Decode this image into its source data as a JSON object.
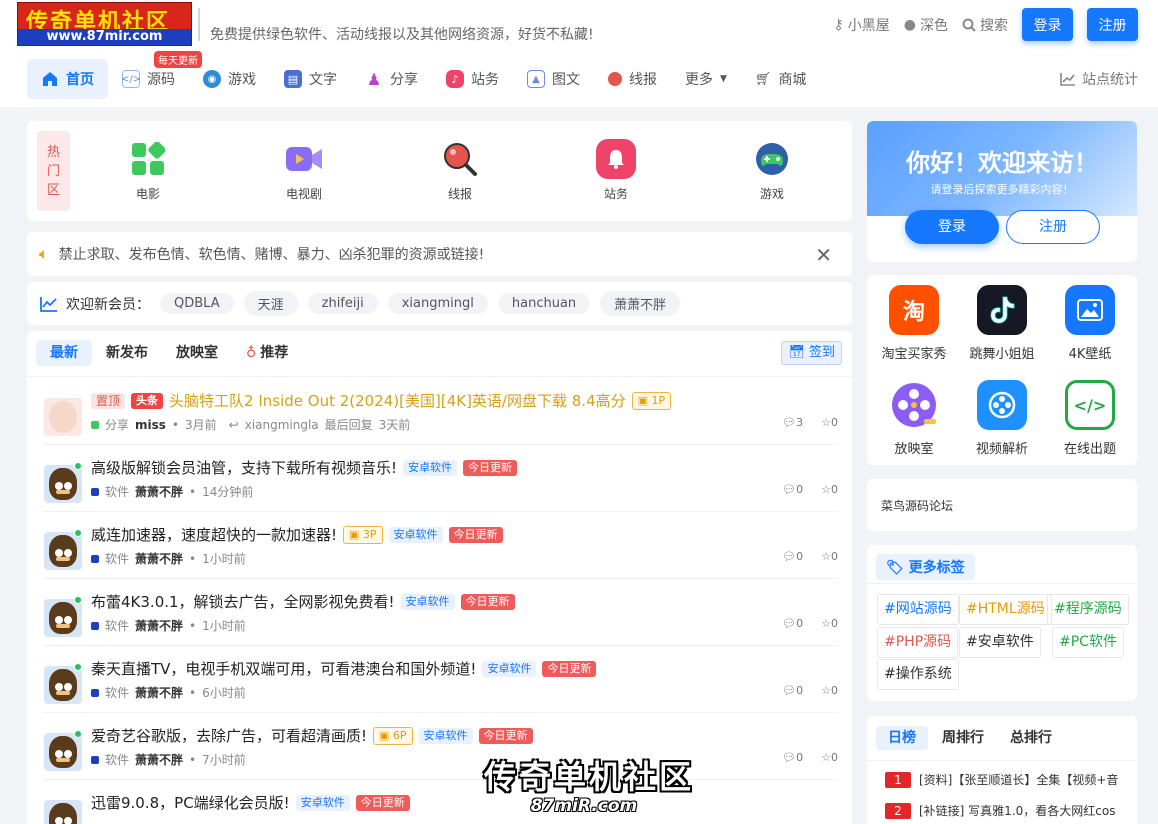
{
  "header": {
    "logo_line1": "传奇单机社区",
    "logo_line2": "www.87mir.com",
    "slogan": "免费提供绿色软件、活动线报以及其他网络资源，好货不私藏!",
    "links": [
      {
        "icon": "key-icon",
        "label": "小黑屋"
      },
      {
        "icon": "moon-icon",
        "label": "深色"
      },
      {
        "icon": "search-icon",
        "label": "搜索"
      }
    ],
    "login": "登录",
    "register": "注册"
  },
  "nav": {
    "items": [
      {
        "label": "首页",
        "icon": "home-icon"
      },
      {
        "label": "源码",
        "icon": "code-icon"
      },
      {
        "label": "游戏",
        "icon": "game-icon"
      },
      {
        "label": "文字",
        "icon": "book-icon"
      },
      {
        "label": "分享",
        "icon": "share-icon"
      },
      {
        "label": "站务",
        "icon": "bell-icon"
      },
      {
        "label": "图文",
        "icon": "image-icon"
      },
      {
        "label": "线报",
        "icon": "magnifier-icon"
      },
      {
        "label": "更多",
        "icon": "caret-down-icon"
      },
      {
        "label": "商城",
        "icon": "cart-icon"
      }
    ],
    "badge": "每天更新",
    "stats": "站点统计"
  },
  "hot": {
    "label": [
      "热",
      "门",
      "区"
    ],
    "items": [
      {
        "label": "电影",
        "icon": "grid-icon",
        "color": "#3ec95f"
      },
      {
        "label": "电视剧",
        "icon": "video-icon",
        "color": "#8b6cf6"
      },
      {
        "label": "线报",
        "icon": "magnifier-icon",
        "color": "#e4554d"
      },
      {
        "label": "站务",
        "icon": "bell-icon",
        "color": "#f0436a"
      },
      {
        "label": "游戏",
        "icon": "game-icon",
        "color": "#2e8bd6"
      }
    ]
  },
  "notice": {
    "text": "禁止求取、发布色情、软色情、赌博、暴力、凶杀犯罪的资源或链接!"
  },
  "members": {
    "label": "欢迎新会员：",
    "names": [
      "QDBLA",
      "天涯",
      "zhifeiji",
      "xiangmingl",
      "hanchuan",
      "萧萧不胖"
    ]
  },
  "tabs": {
    "items": [
      "最新",
      "新发布",
      "放映室",
      "推荐"
    ],
    "signin": "签到"
  },
  "posts": [
    {
      "pin": "置顶",
      "head": "头条",
      "title": "头脑特工队2 Inside Out 2(2024)[美国][4K]英语/网盘下载 8.4高分",
      "pics": "1P",
      "category": "分享",
      "cat_color": "#3ec95f",
      "author": "miss",
      "time": "3月前",
      "reply_user": "xiangmingla",
      "reply_label": "最后回复",
      "reply_time": "3天前",
      "comments": "3",
      "stars": "0"
    },
    {
      "title": "高级版解锁会员油管，支持下载所有视频音乐!",
      "cat_tag": "安卓软件",
      "today": "今日更新",
      "category": "软件",
      "cat_color": "#1d3fbf",
      "author": "萧萧不胖",
      "time": "14分钟前",
      "comments": "0",
      "stars": "0"
    },
    {
      "title": "威连加速器，速度超快的一款加速器!",
      "pics": "3P",
      "cat_tag": "安卓软件",
      "today": "今日更新",
      "category": "软件",
      "cat_color": "#1d3fbf",
      "author": "萧萧不胖",
      "time": "1小时前",
      "comments": "0",
      "stars": "0"
    },
    {
      "title": "布蕾4K3.0.1，解锁去广告，全网影视免费看!",
      "cat_tag": "安卓软件",
      "today": "今日更新",
      "category": "软件",
      "cat_color": "#1d3fbf",
      "author": "萧萧不胖",
      "time": "1小时前",
      "comments": "0",
      "stars": "0"
    },
    {
      "title": "秦天直播TV，电视手机双端可用，可看港澳台和国外频道!",
      "cat_tag": "安卓软件",
      "today": "今日更新",
      "category": "软件",
      "cat_color": "#1d3fbf",
      "author": "萧萧不胖",
      "time": "6小时前",
      "comments": "0",
      "stars": "0"
    },
    {
      "title": "爱奇艺谷歌版，去除广告，可看超清画质!",
      "pics": "6P",
      "cat_tag": "安卓软件",
      "today": "今日更新",
      "category": "软件",
      "cat_color": "#1d3fbf",
      "author": "萧萧不胖",
      "time": "7小时前",
      "comments": "0",
      "stars": "0"
    },
    {
      "title": "迅雷9.0.8，PC端绿化会员版!",
      "cat_tag": "安卓软件",
      "today": "今日更新"
    }
  ],
  "welcome": {
    "title": "你好！欢迎来访！",
    "subtitle": "请登录后探索更多精彩内容！",
    "login": "登录",
    "register": "注册"
  },
  "apps": [
    {
      "label": "淘宝买家秀",
      "glyph": "淘",
      "color": "#ff5000"
    },
    {
      "label": "跳舞小姐姐",
      "glyph": "♪",
      "color": "#161823"
    },
    {
      "label": "4K壁纸",
      "glyph": "▣",
      "color": "#1677ff"
    },
    {
      "label": "放映室",
      "glyph": "✇",
      "color": "#8b5cf6"
    },
    {
      "label": "视频解析",
      "glyph": "▶",
      "color": "#1e90ff"
    },
    {
      "label": "在线出题",
      "glyph": "</>",
      "color": "#22a845"
    }
  ],
  "forum_link": "菜鸟源码论坛",
  "tag_box": {
    "title": "更多标签",
    "tags": [
      {
        "label": "#网站源码",
        "color": "#1677ff"
      },
      {
        "label": "#HTML源码",
        "color": "#e59b0c"
      },
      {
        "label": "#程序源码",
        "color": "#22a845"
      },
      {
        "label": "#PHP源码",
        "color": "#e4554d"
      },
      {
        "label": "#安卓软件",
        "color": "#333333"
      },
      {
        "label": "#PC软件",
        "color": "#22a845"
      },
      {
        "label": "#操作系统",
        "color": "#333333"
      }
    ]
  },
  "ranking": {
    "tabs": [
      "日榜",
      "周排行",
      "总排行"
    ],
    "items": [
      {
        "num": "1",
        "text": "[资料]【张至顺道长】全集【视频+音"
      },
      {
        "num": "2",
        "text": "[补链接] 写真雅1.0，看各大网红cos"
      }
    ]
  },
  "watermark": {
    "line1": "传奇单机社区",
    "line2": "87miR.com"
  }
}
